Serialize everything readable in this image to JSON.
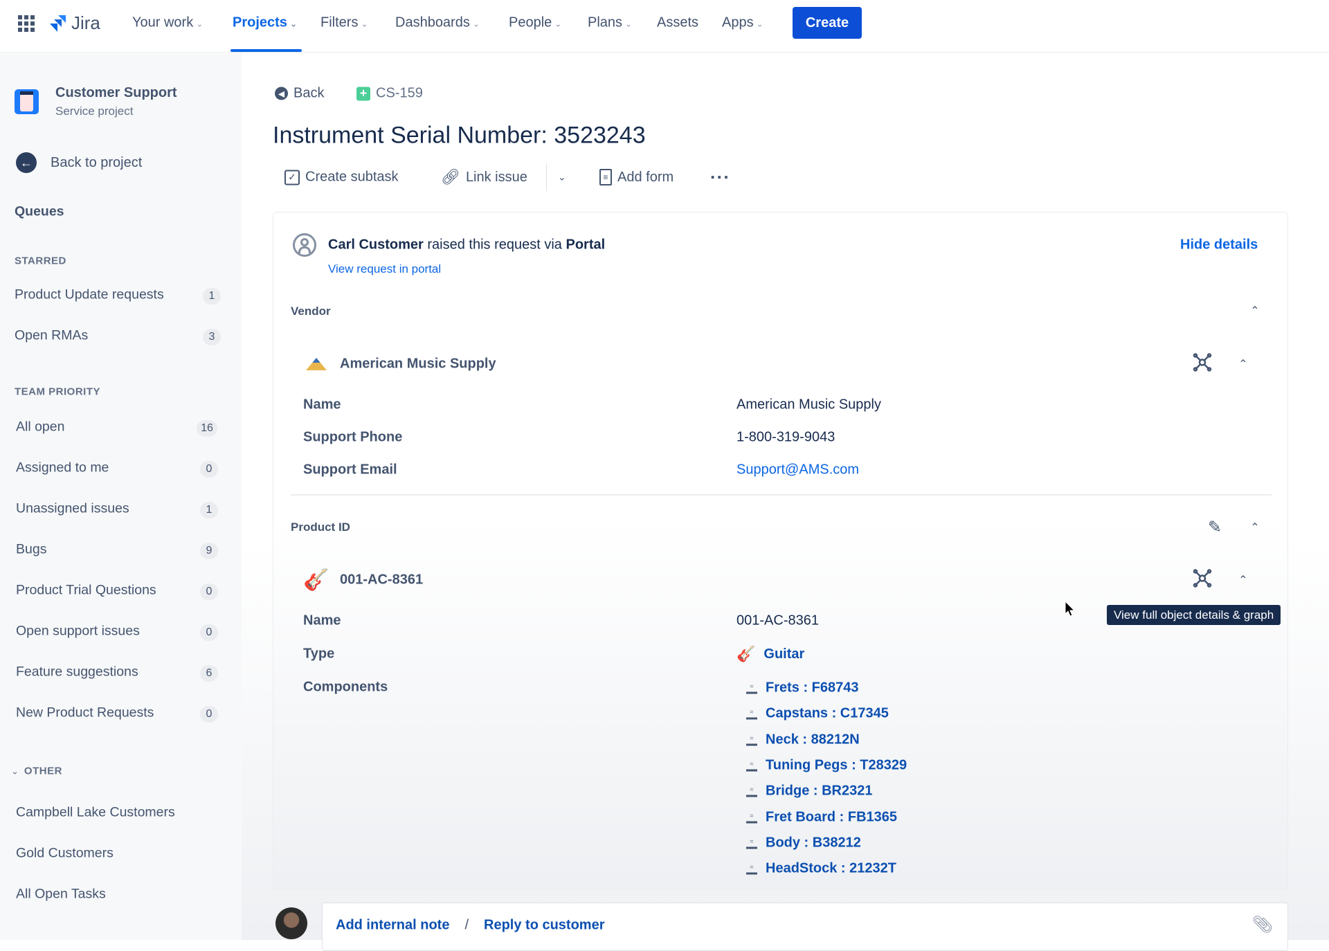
{
  "topbar": {
    "app_name": "Jira",
    "nav": [
      {
        "label": "Your work",
        "dropdown": true
      },
      {
        "label": "Projects",
        "dropdown": true,
        "active": true
      },
      {
        "label": "Filters",
        "dropdown": true
      },
      {
        "label": "Dashboards",
        "dropdown": true
      },
      {
        "label": "People",
        "dropdown": true
      },
      {
        "label": "Plans",
        "dropdown": true
      },
      {
        "label": "Assets",
        "dropdown": false
      },
      {
        "label": "Apps",
        "dropdown": true
      }
    ],
    "create_label": "Create",
    "accent": "#0c66e4"
  },
  "sidebar": {
    "project_name": "Customer Support",
    "project_type": "Service project",
    "back_label": "Back to project",
    "queues_label": "Queues",
    "starred_heading": "STARRED",
    "starred": [
      {
        "label": "Product Update requests",
        "count": "1"
      },
      {
        "label": "Open RMAs",
        "count": "3"
      }
    ],
    "team_heading": "TEAM PRIORITY",
    "team": [
      {
        "label": "All open",
        "count": "16"
      },
      {
        "label": "Assigned to me",
        "count": "0"
      },
      {
        "label": "Unassigned issues",
        "count": "1"
      },
      {
        "label": "Bugs",
        "count": "9"
      },
      {
        "label": "Product Trial Questions",
        "count": "0"
      },
      {
        "label": "Open support issues",
        "count": "0"
      },
      {
        "label": "Feature suggestions",
        "count": "6"
      },
      {
        "label": "New Product Requests",
        "count": "0"
      }
    ],
    "other_heading": "OTHER",
    "other": [
      {
        "label": "Campbell Lake Customers"
      },
      {
        "label": "Gold Customers"
      },
      {
        "label": "All Open Tasks"
      }
    ]
  },
  "issue": {
    "back_label": "Back",
    "key": "CS-159",
    "title": "Instrument Serial Number: 3523243",
    "toolbar": {
      "create_subtask": "Create subtask",
      "link_issue": "Link issue",
      "add_form": "Add form"
    },
    "request": {
      "reporter": "Carl Customer",
      "middle": "raised this request via",
      "channel": "Portal",
      "view_portal": "View request in portal",
      "hide_details": "Hide details"
    },
    "vendor": {
      "section_label": "Vendor",
      "object_name": "American Music Supply",
      "fields": [
        {
          "label": "Name",
          "value": "American Music Supply"
        },
        {
          "label": "Support Phone",
          "value": "1-800-319-9043"
        },
        {
          "label": "Support Email",
          "value": "Support@AMS.com",
          "link": true
        }
      ]
    },
    "product": {
      "section_label": "Product ID",
      "object_name": "001-AC-8361",
      "name_label": "Name",
      "name_value": "001-AC-8361",
      "type_label": "Type",
      "type_value": "Guitar",
      "components_label": "Components",
      "components": [
        "Frets : F68743",
        "Capstans : C17345",
        "Neck : 88212N",
        "Tuning Pegs : T28329",
        "Bridge : BR2321",
        "Fret Board : FB1365",
        "Body : B38212",
        "HeadStock : 21232T"
      ]
    },
    "tooltip": "View full object details & graph",
    "comment": {
      "add_note": "Add internal note",
      "separator": "/",
      "reply": "Reply to customer"
    }
  }
}
